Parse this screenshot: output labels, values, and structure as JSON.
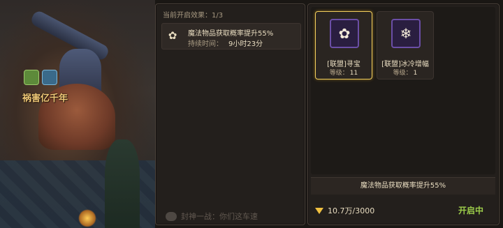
{
  "scene": {
    "banner": "祸害亿千年"
  },
  "effects": {
    "header_label": "当前开启效果：",
    "count": "1/3",
    "items": [
      {
        "icon": "clover-icon",
        "name": "魔法物品获取概率提升55%",
        "duration_label": "持续时间：",
        "duration_value": "9小时23分"
      }
    ]
  },
  "chat": {
    "text": "封神一战：你们这车速"
  },
  "skills": [
    {
      "icon": "clover-icon",
      "title": "[联盟]寻宝",
      "level_label": "等级：",
      "level": "11",
      "selected": true
    },
    {
      "icon": "snowflake-icon",
      "title": "[联盟]冰冷增幅",
      "level_label": "等级：",
      "level": "1",
      "selected": false
    }
  ],
  "description": "魔法物品获取概率提升55%",
  "cost": {
    "icon": "gem-icon",
    "value": "10.7万/3000"
  },
  "status": "开启中",
  "colors": {
    "accent_gold": "#f2cf5e",
    "status_green": "#9ccc4a",
    "skill_frame_purple": "#6b4ea6"
  }
}
